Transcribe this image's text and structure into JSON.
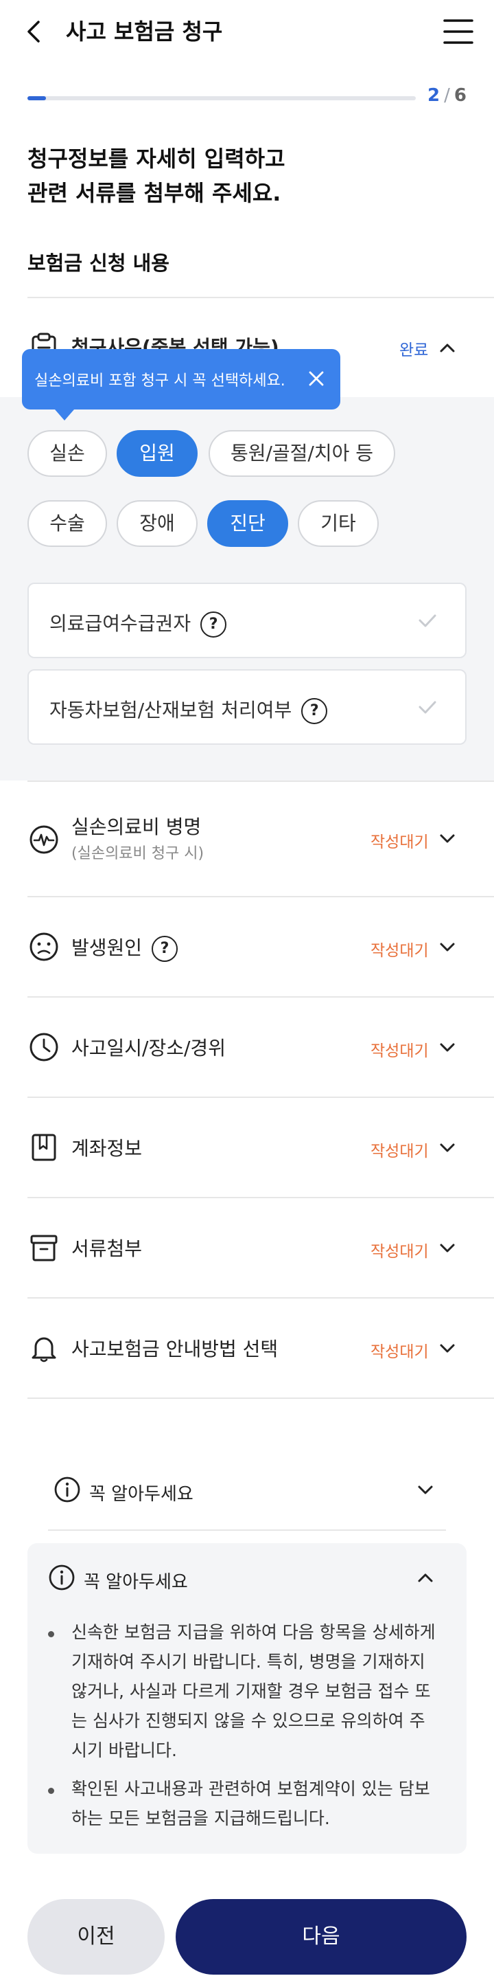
{
  "header": {
    "title": "사고 보험금 청구",
    "back_icon": "chevron-left-icon",
    "menu_icon": "hamburger-menu-icon"
  },
  "progress": {
    "current": "2",
    "separator": "/",
    "total": "6",
    "fraction": 0.048
  },
  "intro": {
    "line1": "청구정보를 자세히 입력하고",
    "line2": "관련 서류를 첨부해 주세요."
  },
  "section_title": "보험금 신청 내용",
  "reason": {
    "title": "청구사유(중복 선택 가능)",
    "status": "완료",
    "tooltip": "실손의료비 포함 청구 시 꼭 선택하세요.",
    "chips": [
      {
        "label": "실손",
        "selected": false
      },
      {
        "label": "입원",
        "selected": true
      },
      {
        "label": "통원/골절/치아 등",
        "selected": false
      },
      {
        "label": "수술",
        "selected": false
      },
      {
        "label": "장애",
        "selected": false
      },
      {
        "label": "진단",
        "selected": true
      },
      {
        "label": "기타",
        "selected": false
      }
    ],
    "checks": [
      {
        "label": "의료급여수급권자",
        "help": "?"
      },
      {
        "label": "자동차보험/산재보험 처리여부",
        "help": "?"
      }
    ]
  },
  "sections": [
    {
      "title": "실손의료비 병명",
      "subtitle": "(실손의료비 청구 시)",
      "status": "작성대기",
      "icon": "medical-pulse-icon"
    },
    {
      "title": "발생원인",
      "help": "?",
      "status": "작성대기",
      "icon": "sad-face-icon"
    },
    {
      "title": "사고일시/장소/경위",
      "status": "작성대기",
      "icon": "clock-icon"
    },
    {
      "title": "계좌정보",
      "status": "작성대기",
      "icon": "bankbook-icon"
    },
    {
      "title": "서류첨부",
      "status": "작성대기",
      "icon": "archive-box-icon"
    },
    {
      "title": "사고보험금 안내방법 선택",
      "status": "작성대기",
      "icon": "bell-icon"
    }
  ],
  "notice": {
    "title": "꼭 알아두세요",
    "items": [
      "신속한 보험금 지급을 위하여 다음 항목을 상세하게 기재하여 주시기 바랍니다. 특히, 병명을 기재하지 않거나, 사실과 다르게 기재할 경우 보험금 접수 또는 심사가 진행되지 않을 수 있으므로 유의하여 주시기 바랍니다.",
      "확인된 사고내용과 관련하여 보험계약이 있는 담보하는 모든 보험금을 지급해드립니다."
    ]
  },
  "buttons": {
    "prev": "이전",
    "next": "다음"
  },
  "colors": {
    "accent": "#2f66d6",
    "chip_selected": "#2f7de3",
    "pending": "#e8703a",
    "primary_button": "#17226b"
  }
}
